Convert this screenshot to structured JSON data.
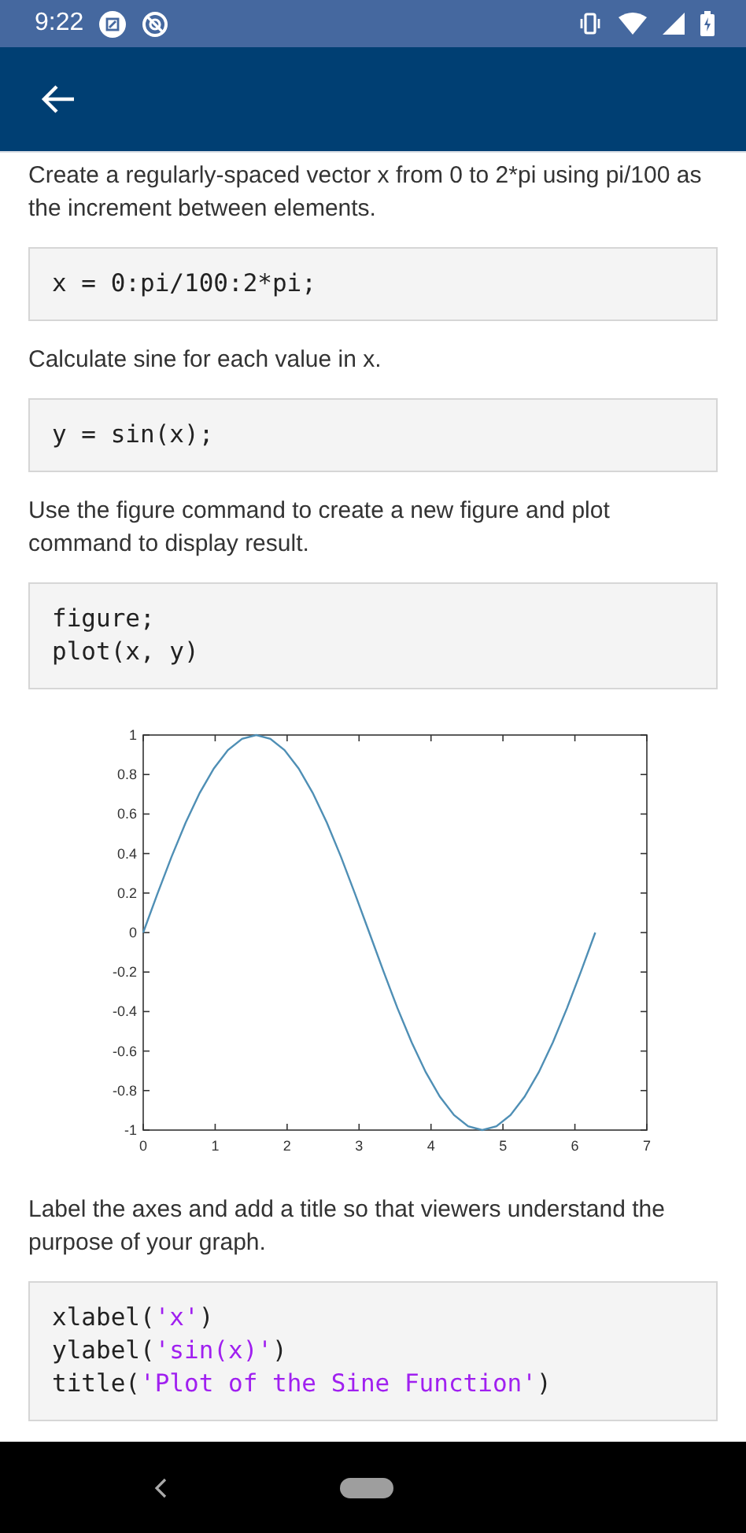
{
  "status_bar": {
    "time": "9:22"
  },
  "content": [
    {
      "kind": "text",
      "text": "Create a regularly-spaced vector x from 0 to 2*pi using pi/100 as the increment between elements."
    },
    {
      "kind": "code",
      "lines": [
        [
          {
            "kind": "plain",
            "text": "x = 0:pi/100:2*pi;"
          }
        ]
      ]
    },
    {
      "kind": "text",
      "text": "Calculate sine for each value in x."
    },
    {
      "kind": "code",
      "lines": [
        [
          {
            "kind": "plain",
            "text": "y = sin(x);"
          }
        ]
      ]
    },
    {
      "kind": "text",
      "text": "Use the figure command to create a new figure and plot command to display result."
    },
    {
      "kind": "code",
      "lines": [
        [
          {
            "kind": "plain",
            "text": "figure;"
          }
        ],
        [
          {
            "kind": "plain",
            "text": "plot(x, y)"
          }
        ]
      ]
    },
    {
      "kind": "chart",
      "chart_data": {
        "type": "line",
        "x": [
          0,
          0.196,
          0.393,
          0.589,
          0.785,
          0.982,
          1.178,
          1.374,
          1.571,
          1.767,
          1.963,
          2.16,
          2.356,
          2.553,
          2.749,
          2.945,
          3.142,
          3.338,
          3.534,
          3.731,
          3.927,
          4.123,
          4.32,
          4.516,
          4.712,
          4.909,
          5.105,
          5.301,
          5.498,
          5.694,
          5.89,
          6.087,
          6.283
        ],
        "series": [
          {
            "color": "#4f8fb5",
            "values": [
              0,
              0.195,
              0.383,
              0.556,
              0.707,
              0.831,
              0.924,
              0.981,
              1,
              0.981,
              0.924,
              0.831,
              0.707,
              0.556,
              0.383,
              0.195,
              0,
              -0.195,
              -0.383,
              -0.556,
              -0.707,
              -0.831,
              -0.924,
              -0.981,
              -1,
              -0.981,
              -0.924,
              -0.831,
              -0.707,
              -0.556,
              -0.383,
              -0.195,
              0
            ]
          }
        ],
        "xlim": [
          0,
          7
        ],
        "ylim": [
          -1,
          1
        ],
        "xticks": [
          0,
          1,
          2,
          3,
          4,
          5,
          6,
          7
        ],
        "yticks": [
          -1,
          -0.8,
          -0.6,
          -0.4,
          -0.2,
          0,
          0.2,
          0.4,
          0.6,
          0.8,
          1
        ]
      }
    },
    {
      "kind": "text",
      "text": "Label the axes and add a title so that viewers understand the purpose of your graph."
    },
    {
      "kind": "code",
      "lines": [
        [
          {
            "kind": "plain",
            "text": "xlabel("
          },
          {
            "kind": "string",
            "text": "'x'"
          },
          {
            "kind": "plain",
            "text": ")"
          }
        ],
        [
          {
            "kind": "plain",
            "text": "ylabel("
          },
          {
            "kind": "string",
            "text": "'sin(x)'"
          },
          {
            "kind": "plain",
            "text": ")"
          }
        ],
        [
          {
            "kind": "plain",
            "text": "title("
          },
          {
            "kind": "string",
            "text": "'Plot of the Sine Function'"
          },
          {
            "kind": "plain",
            "text": ")"
          }
        ]
      ]
    }
  ]
}
